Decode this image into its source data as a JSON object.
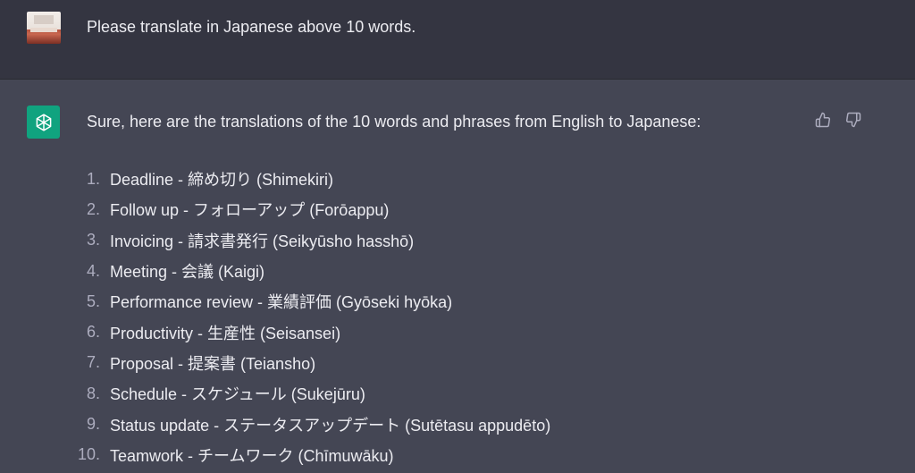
{
  "user_message": {
    "text": "Please translate in Japanese above 10 words."
  },
  "assistant_message": {
    "intro": "Sure, here are the translations of the 10 words and phrases from English to Japanese:",
    "items": [
      {
        "num": "1.",
        "text": "Deadline - 締め切り (Shimekiri)"
      },
      {
        "num": "2.",
        "text": "Follow up - フォローアップ (Forōappu)"
      },
      {
        "num": "3.",
        "text": "Invoicing - 請求書発行 (Seikyūsho hasshō)"
      },
      {
        "num": "4.",
        "text": "Meeting - 会議 (Kaigi)"
      },
      {
        "num": "5.",
        "text": "Performance review - 業績評価 (Gyōseki hyōka)"
      },
      {
        "num": "6.",
        "text": "Productivity - 生産性 (Seisansei)"
      },
      {
        "num": "7.",
        "text": "Proposal - 提案書 (Teiansho)"
      },
      {
        "num": "8.",
        "text": "Schedule - スケジュール (Sukejūru)"
      },
      {
        "num": "9.",
        "text": "Status update - ステータスアップデート (Sutētasu appudēto)"
      },
      {
        "num": "10.",
        "text": "Teamwork - チームワーク (Chīmuwāku)"
      }
    ]
  },
  "icons": {
    "user_avatar": "user-avatar-image",
    "assistant_avatar": "openai-logo-icon",
    "thumbs_up": "thumbs-up-icon",
    "thumbs_down": "thumbs-down-icon"
  },
  "colors": {
    "user_bg": "#343541",
    "assistant_bg": "#444654",
    "accent": "#10a37f",
    "text": "#ececf1",
    "muted": "#acacbe"
  }
}
